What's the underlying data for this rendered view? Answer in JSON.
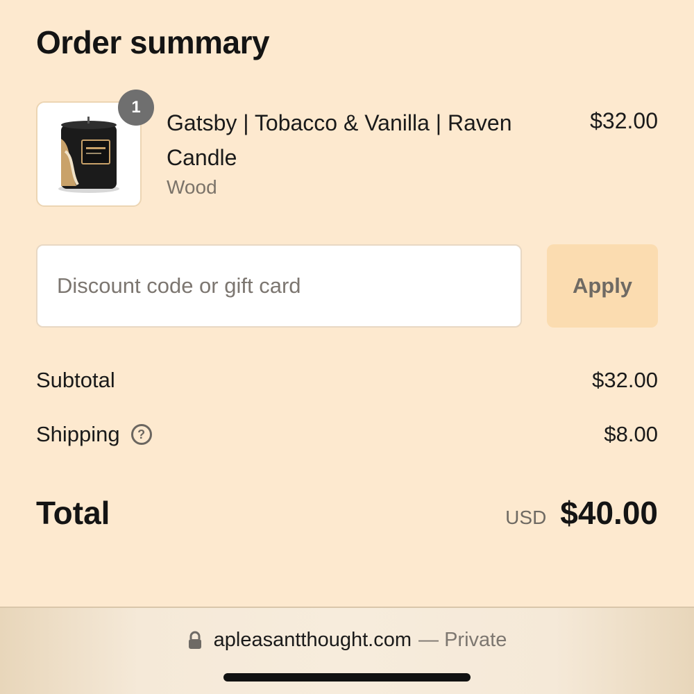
{
  "header": {
    "title": "Order summary"
  },
  "line_item": {
    "quantity": "1",
    "name": "Gatsby | Tobacco & Vanilla | Raven Candle",
    "variant": "Wood",
    "price": "$32.00",
    "image_icon": "candle-product-image"
  },
  "discount": {
    "placeholder": "Discount code or gift card",
    "value": "",
    "apply_label": "Apply"
  },
  "totals": {
    "subtotal_label": "Subtotal",
    "subtotal_value": "$32.00",
    "shipping_label": "Shipping",
    "shipping_help_icon": "question-circle-icon",
    "shipping_value": "$8.00",
    "total_label": "Total",
    "currency": "USD",
    "total_value": "$40.00"
  },
  "browser": {
    "lock_icon": "lock-icon",
    "domain": "apleasantthought.com",
    "mode": "— Private"
  },
  "colors": {
    "background": "#fde9cf",
    "apply_button": "#fbdcb0",
    "badge": "#6f6f6f"
  }
}
